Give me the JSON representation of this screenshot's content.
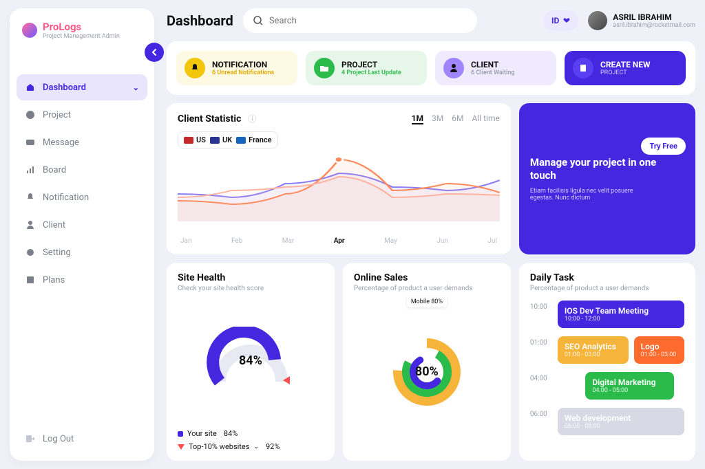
{
  "brand": {
    "name": "ProLogs",
    "tag": "Project Management Admin"
  },
  "nav": {
    "items": [
      {
        "label": "Dashboard",
        "icon": "home-icon",
        "active": true
      },
      {
        "label": "Project",
        "icon": "chart-icon"
      },
      {
        "label": "Message",
        "icon": "mail-icon"
      },
      {
        "label": "Board",
        "icon": "bars-icon"
      },
      {
        "label": "Notification",
        "icon": "bell-icon"
      },
      {
        "label": "Client",
        "icon": "user-icon"
      },
      {
        "label": "Setting",
        "icon": "gear-icon"
      },
      {
        "label": "Plans",
        "icon": "book-icon"
      }
    ],
    "logout": "Log Out"
  },
  "header": {
    "title": "Dashboard",
    "search_placeholder": "Search",
    "lang": "ID",
    "user": {
      "name": "ASRIL IBRAHIM",
      "email": "asril.ibrahim@rocketmail.com"
    }
  },
  "cards": [
    {
      "title": "NOTIFICATION",
      "sub": "6 Unread Notifications",
      "tone": "yellow",
      "icon": "bell-icon"
    },
    {
      "title": "PROJECT",
      "sub": "4 Project Last Update",
      "tone": "green",
      "icon": "folder-icon"
    },
    {
      "title": "CLIENT",
      "sub": "6 Client Waiting",
      "tone": "lav",
      "icon": "user-icon"
    },
    {
      "title": "CREATE NEW",
      "sub": "PROJECT",
      "tone": "purple",
      "icon": "plus-icon"
    }
  ],
  "client_stat": {
    "title": "Client Statistic",
    "countries": [
      {
        "code": "US",
        "flag": "#c62828"
      },
      {
        "code": "UK",
        "flag": "#283593"
      },
      {
        "code": "France",
        "flag": "#1565c0"
      }
    ],
    "ranges": [
      "1M",
      "3M",
      "6M",
      "All time"
    ],
    "active_range": "1M",
    "x": [
      "Jan",
      "Feb",
      "Mar",
      "Apr",
      "May",
      "Jun",
      "Jul"
    ],
    "active_x": "Apr"
  },
  "manage": {
    "title": "Manage your project in one touch",
    "desc": "Etiam facilisis ligula nec velit posuere egestas. Nunc dictum",
    "cta": "Try Free"
  },
  "site_health": {
    "title": "Site Health",
    "sub": "Check your site health score",
    "value": "84%",
    "legend": [
      {
        "label": "Your site",
        "val": "84%",
        "color": "#4527e0"
      },
      {
        "label": "Top-10% websites",
        "val": "92%",
        "marker": "tri"
      }
    ]
  },
  "online_sales": {
    "title": "Online Sales",
    "sub": "Percentage of product a user demands",
    "value": "80%",
    "tag": "Mobile 80%"
  },
  "daily_task": {
    "title": "Daily Task",
    "sub": "Percentage of product a user demands",
    "rows": [
      {
        "time": "10:00",
        "blocks": [
          {
            "title": "IOS Dev Team Meeting",
            "time": "10:00 - 12:00",
            "tone": "blue"
          }
        ]
      },
      {
        "time": "01:00",
        "blocks": [
          {
            "title": "SEO Analytics",
            "time": "01:00 - 03:00",
            "tone": "amber"
          },
          {
            "title": "Logo",
            "time": "01:00 - 03:00",
            "tone": "orange"
          }
        ]
      },
      {
        "time": "04:00",
        "blocks": [
          {
            "title": "Digital Marketing",
            "time": "04:00 - 05:00",
            "tone": "green"
          }
        ]
      },
      {
        "time": "06:00",
        "blocks": [
          {
            "title": "Web development",
            "time": "06:00 - 08:00",
            "tone": "grey"
          }
        ]
      }
    ]
  },
  "chart_data": {
    "type": "line",
    "title": "Client Statistic",
    "x": [
      "Jan",
      "Feb",
      "Mar",
      "Apr",
      "May",
      "Jun",
      "Jul"
    ],
    "series": [
      {
        "name": "US",
        "color": "#8b7ff7",
        "values": [
          40,
          35,
          55,
          70,
          50,
          45,
          60
        ]
      },
      {
        "name": "UK",
        "color": "#ff8a5c",
        "values": [
          30,
          25,
          40,
          90,
          45,
          55,
          42
        ]
      },
      {
        "name": "France",
        "color": "#ffb3a0",
        "values": [
          35,
          45,
          50,
          65,
          35,
          40,
          38
        ]
      }
    ],
    "ylim": [
      0,
      100
    ]
  }
}
